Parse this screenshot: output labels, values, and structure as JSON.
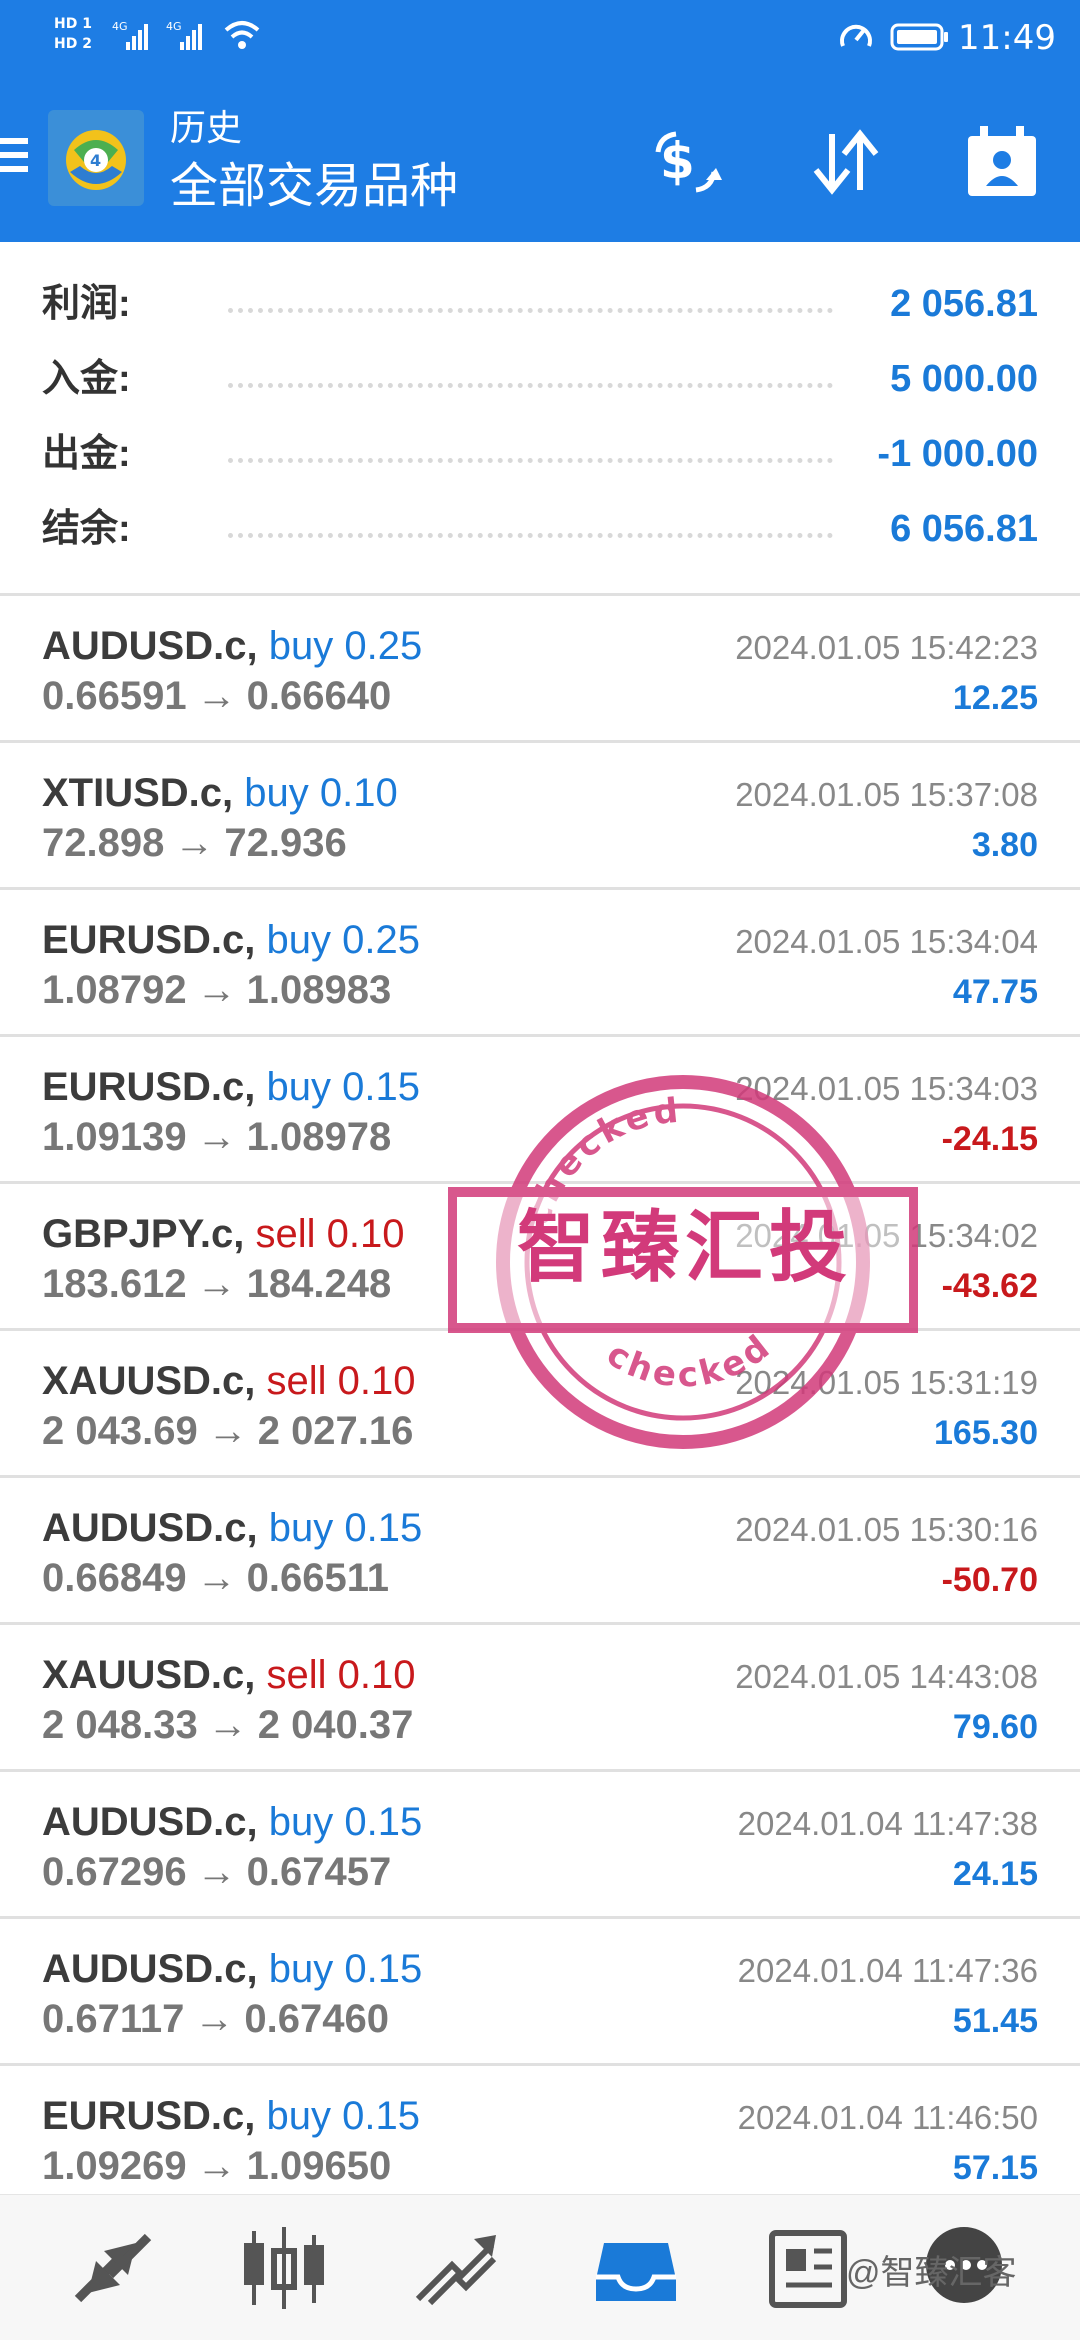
{
  "status_bar": {
    "network_badge_1": "HD 1",
    "network_badge_2": "HD 2",
    "signal_label": "4G",
    "time": "11:49"
  },
  "app_bar": {
    "title_small": "历史",
    "title_large": "全部交易品种",
    "icons": [
      "menu-icon",
      "metatrader-logo",
      "currency-exchange-icon",
      "sort-icon",
      "calendar-icon"
    ]
  },
  "summary": [
    {
      "label": "利润:",
      "value": "2 056.81"
    },
    {
      "label": "入金:",
      "value": "5 000.00"
    },
    {
      "label": "出金:",
      "value": "-1 000.00"
    },
    {
      "label": "结余:",
      "value": "6 056.81"
    }
  ],
  "trades": [
    {
      "symbol": "AUDUSD.c,",
      "type": "buy",
      "volume": "0.25",
      "open": "0.66591",
      "close": "0.66640",
      "time": "2024.01.05 15:42:23",
      "profit": "12.25"
    },
    {
      "symbol": "XTIUSD.c,",
      "type": "buy",
      "volume": "0.10",
      "open": "72.898",
      "close": "72.936",
      "time": "2024.01.05 15:37:08",
      "profit": "3.80"
    },
    {
      "symbol": "EURUSD.c,",
      "type": "buy",
      "volume": "0.25",
      "open": "1.08792",
      "close": "1.08983",
      "time": "2024.01.05 15:34:04",
      "profit": "47.75"
    },
    {
      "symbol": "EURUSD.c,",
      "type": "buy",
      "volume": "0.15",
      "open": "1.09139",
      "close": "1.08978",
      "time": "2024.01.05 15:34:03",
      "profit": "-24.15"
    },
    {
      "symbol": "GBPJPY.c,",
      "type": "sell",
      "volume": "0.10",
      "open": "183.612",
      "close": "184.248",
      "time": "2024.01.05 15:34:02",
      "profit": "-43.62"
    },
    {
      "symbol": "XAUUSD.c,",
      "type": "sell",
      "volume": "0.10",
      "open": "2 043.69",
      "close": "2 027.16",
      "time": "2024.01.05 15:31:19",
      "profit": "165.30"
    },
    {
      "symbol": "AUDUSD.c,",
      "type": "buy",
      "volume": "0.15",
      "open": "0.66849",
      "close": "0.66511",
      "time": "2024.01.05 15:30:16",
      "profit": "-50.70"
    },
    {
      "symbol": "XAUUSD.c,",
      "type": "sell",
      "volume": "0.10",
      "open": "2 048.33",
      "close": "2 040.37",
      "time": "2024.01.05 14:43:08",
      "profit": "79.60"
    },
    {
      "symbol": "AUDUSD.c,",
      "type": "buy",
      "volume": "0.15",
      "open": "0.67296",
      "close": "0.67457",
      "time": "2024.01.04 11:47:38",
      "profit": "24.15"
    },
    {
      "symbol": "AUDUSD.c,",
      "type": "buy",
      "volume": "0.15",
      "open": "0.67117",
      "close": "0.67460",
      "time": "2024.01.04 11:47:36",
      "profit": "51.45"
    },
    {
      "symbol": "EURUSD.c,",
      "type": "buy",
      "volume": "0.15",
      "open": "1.09269",
      "close": "1.09650",
      "time": "2024.01.04 11:46:50",
      "profit": "57.15"
    }
  ],
  "arrow": "→",
  "stamp": {
    "text": "智臻汇投",
    "ring_text": "checked",
    "color": "#d23a7a"
  },
  "bottom_nav": {
    "items": [
      "quotes-icon",
      "chart-icon",
      "trade-icon",
      "history-icon",
      "news-icon",
      "chat-icon"
    ],
    "active": "history-icon",
    "watermark": "@智臻汇客"
  },
  "colors": {
    "header": "#1e7de4",
    "positive": "#1a7ad8",
    "negative": "#c8191c"
  }
}
